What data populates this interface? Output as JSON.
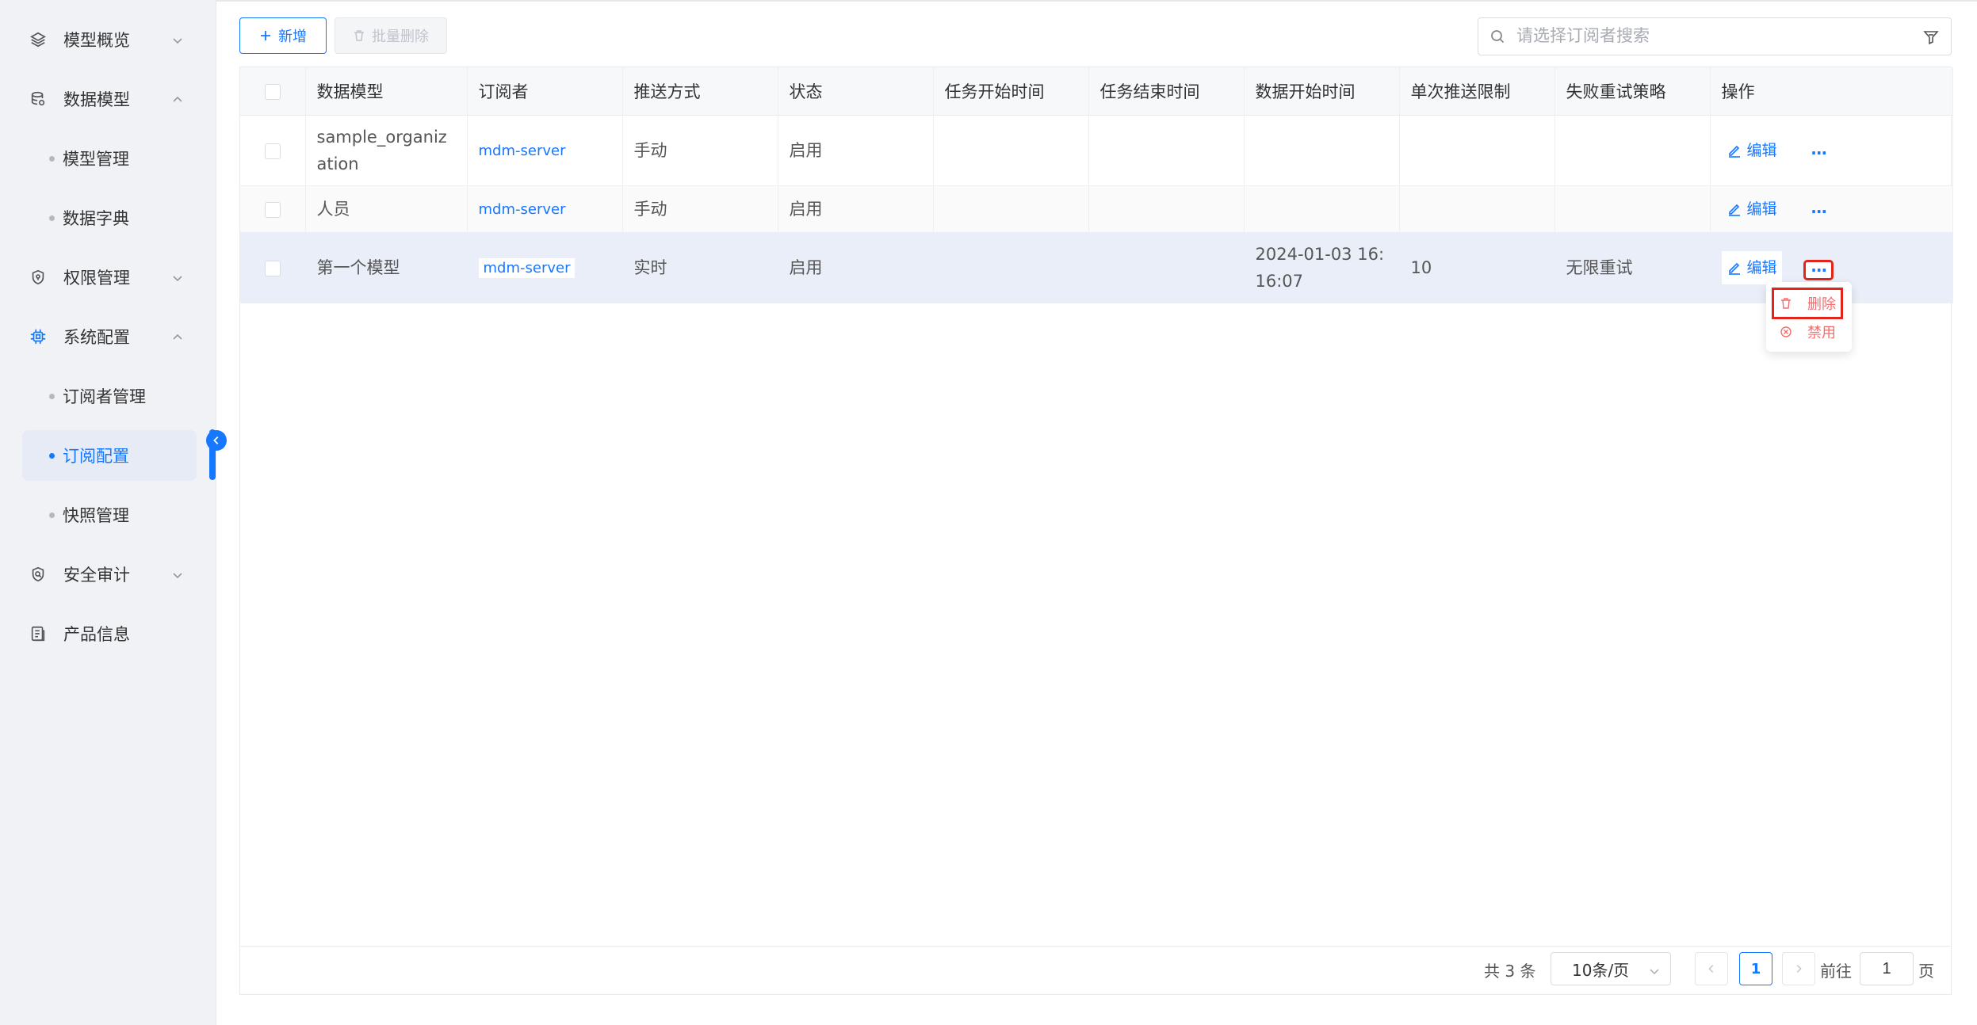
{
  "sidebar": {
    "items": [
      {
        "label": "模型概览",
        "icon": "layers-icon",
        "expanded": false
      },
      {
        "label": "数据模型",
        "icon": "database-icon",
        "expanded": true,
        "children": [
          {
            "label": "模型管理"
          },
          {
            "label": "数据字典"
          }
        ]
      },
      {
        "label": "权限管理",
        "icon": "shield-icon",
        "expanded": false
      },
      {
        "label": "系统配置",
        "icon": "chip-icon",
        "expanded": true,
        "active": true,
        "children": [
          {
            "label": "订阅者管理"
          },
          {
            "label": "订阅配置",
            "active": true
          },
          {
            "label": "快照管理"
          }
        ]
      },
      {
        "label": "安全审计",
        "icon": "audit-shield-icon",
        "expanded": false
      },
      {
        "label": "产品信息",
        "icon": "document-icon"
      }
    ]
  },
  "toolbar": {
    "add_label": "新增",
    "batch_delete_label": "批量删除",
    "search_placeholder": "请选择订阅者搜索"
  },
  "table": {
    "columns": [
      "数据模型",
      "订阅者",
      "推送方式",
      "状态",
      "任务开始时间",
      "任务结束时间",
      "数据开始时间",
      "单次推送限制",
      "失败重试策略",
      "操作"
    ],
    "rows": [
      {
        "model": "sample_organization",
        "subscriber": "mdm-server",
        "push": "手动",
        "status": "启用",
        "task_start": "",
        "task_end": "",
        "data_start": "",
        "limit": "",
        "retry": "",
        "edit": "编辑",
        "more": "···"
      },
      {
        "model": "人员",
        "subscriber": "mdm-server",
        "push": "手动",
        "status": "启用",
        "task_start": "",
        "task_end": "",
        "data_start": "",
        "limit": "",
        "retry": "",
        "edit": "编辑",
        "more": "···"
      },
      {
        "model": "第一个模型",
        "subscriber": "mdm-server",
        "push": "实时",
        "status": "启用",
        "task_start": "",
        "task_end": "",
        "data_start": "2024-01-03 16:16:07",
        "limit": "10",
        "retry": "无限重试",
        "edit": "编辑",
        "more": "···"
      }
    ]
  },
  "dropdown": {
    "items": [
      {
        "label": "删除",
        "icon": "trash-icon"
      },
      {
        "label": "禁用",
        "icon": "circle-x-icon"
      }
    ]
  },
  "pagination": {
    "total": "共 3 条",
    "page_size": "10条/页",
    "current_page": "1",
    "goto_label": "前往",
    "goto_value": "1",
    "page_suffix": "页"
  },
  "colors": {
    "accent": "#1677ff",
    "danger": "#f56c6c",
    "highlight": "#e1251b"
  }
}
